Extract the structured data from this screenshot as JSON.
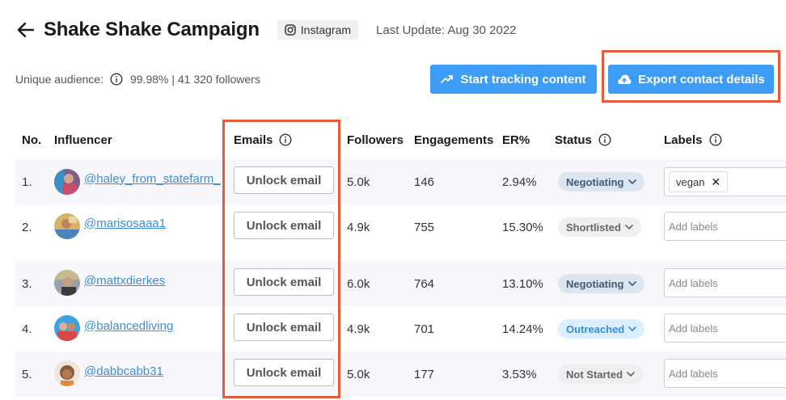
{
  "header": {
    "title": "Shake Shake Campaign",
    "platform": "Instagram",
    "last_update": "Last Update: Aug 30 2022"
  },
  "audience": {
    "label": "Unique audience:",
    "value": "99.98% | 41 320 followers"
  },
  "actions": {
    "track_label": "Start tracking content",
    "export_label": "Export contact details"
  },
  "table": {
    "columns": {
      "no": "No.",
      "influencer": "Influencer",
      "emails": "Emails",
      "followers": "Followers",
      "engagements": "Engagements",
      "er": "ER%",
      "status": "Status",
      "labels": "Labels"
    },
    "unlock_label": "Unlock email",
    "labels_placeholder": "Add labels",
    "rows": [
      {
        "no": "1.",
        "handle": "@haley_from_statefarm_",
        "followers": "5.0k",
        "engagements": "146",
        "er": "2.94%",
        "status": "Negotiating",
        "label": "vegan"
      },
      {
        "no": "2.",
        "handle": "@marisosaaa1",
        "followers": "4.9k",
        "engagements": "755",
        "er": "15.30%",
        "status": "Shortlisted",
        "label": ""
      },
      {
        "no": "3.",
        "handle": "@mattxdierkes",
        "followers": "6.0k",
        "engagements": "764",
        "er": "13.10%",
        "status": "Negotiating",
        "label": ""
      },
      {
        "no": "4.",
        "handle": "@balancedliving",
        "followers": "4.9k",
        "engagements": "701",
        "er": "14.24%",
        "status": "Outreached",
        "label": ""
      },
      {
        "no": "5.",
        "handle": "@dabbcabb31",
        "followers": "5.0k",
        "engagements": "177",
        "er": "3.53%",
        "status": "Not Started",
        "label": ""
      }
    ]
  },
  "colors": {
    "accent": "#3d9cf5",
    "highlight": "#e85a3c",
    "link": "#3d8fd6",
    "status_negotiating_bg": "#dce6ef",
    "status_negotiating_fg": "#3e5a78",
    "status_shortlisted_bg": "#efefef",
    "status_shortlisted_fg": "#666666",
    "status_outreached_bg": "#dcefff",
    "status_outreached_fg": "#2e8fe0",
    "status_notstarted_bg": "#efefef",
    "status_notstarted_fg": "#666666"
  },
  "icons": {
    "back": "arrow-left-icon",
    "platform": "instagram-icon",
    "info": "info-circle-icon",
    "track": "trending-up-icon",
    "export": "cloud-upload-icon",
    "status_dropdown": "chevron-down-icon",
    "label_remove": "close-icon"
  }
}
